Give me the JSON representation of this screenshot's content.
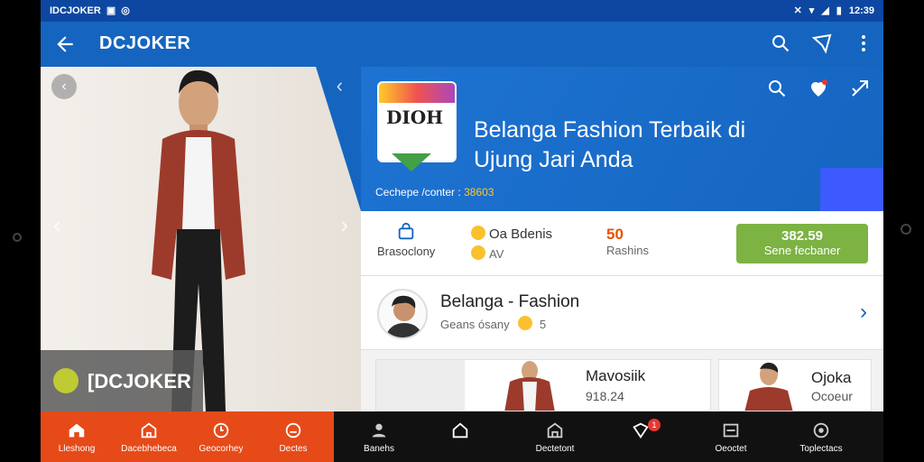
{
  "status_bar": {
    "left_text": "IDCJOKER",
    "time": "12:39"
  },
  "app_bar": {
    "title": "DCJOKER",
    "actions": [
      "search-icon",
      "share-icon",
      "more-icon"
    ]
  },
  "hero": {
    "brand_label": "[DCJOKER"
  },
  "banner": {
    "logo_text": "DIOH",
    "tagline_line1": "Belanga Fashion Terbaik di",
    "tagline_line2": "Ujung Jari Anda",
    "note_label": "Cechepe /conter :",
    "note_value": "38603"
  },
  "stats": {
    "stat1_label": "Brasoclony",
    "stat2_title": "Oa Bdenis",
    "stat2_sub": "AV",
    "stat3_value": "50",
    "stat3_label": "Rashins",
    "cta_price": "382.59",
    "cta_label": "Sene fecbaner"
  },
  "shop": {
    "name": "Belanga - Fashion",
    "sub": "Geans ósany",
    "rating": "5"
  },
  "products": [
    {
      "name": "Mavosiik",
      "price": "918.24"
    },
    {
      "name": "Ojoka",
      "price": "Ocoeur"
    }
  ],
  "bottom_nav": [
    {
      "label": "Lleshong",
      "icon": "home-icon"
    },
    {
      "label": "Dacebhebeca",
      "icon": "store-icon"
    },
    {
      "label": "Geocorhey",
      "icon": "clock-icon"
    },
    {
      "label": "Dectes",
      "icon": "gauge-icon"
    },
    {
      "label": "Banehs",
      "icon": "person-icon"
    },
    {
      "label": "",
      "icon": "home-outline-icon"
    },
    {
      "label": "Dectetont",
      "icon": "shop-icon"
    },
    {
      "label": "",
      "icon": "tag-icon",
      "badge": "1"
    },
    {
      "label": "Oeoctet",
      "icon": "photo-icon"
    },
    {
      "label": "Toplectacs",
      "icon": "target-icon"
    }
  ],
  "colors": {
    "primary": "#1565c0",
    "accent_red": "#e64a19",
    "cta_green": "#7cb342"
  }
}
